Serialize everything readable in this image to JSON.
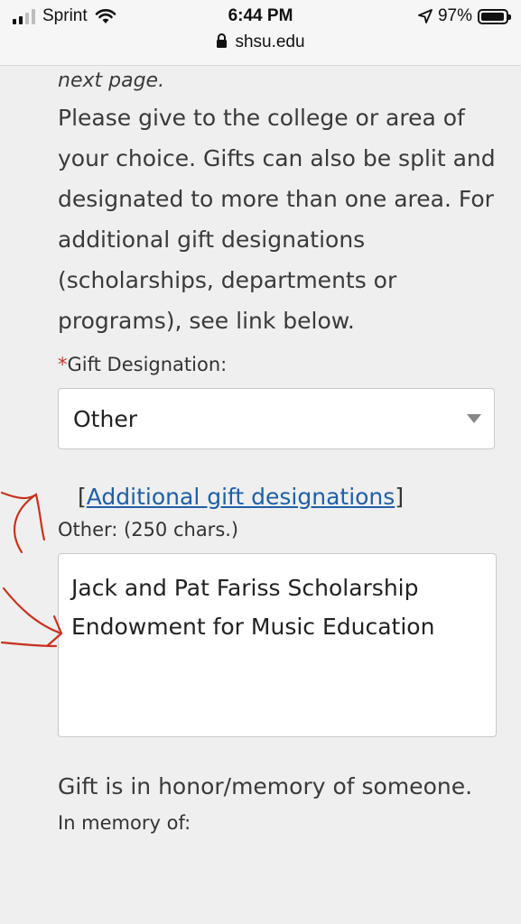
{
  "status_bar": {
    "carrier": "Sprint",
    "time": "6:44 PM",
    "battery": "97%",
    "battery_level": 0.97,
    "url": "shsu.edu"
  },
  "page": {
    "intro_italic": "next page.",
    "description": " Please give to the college or area of your choice. Gifts can also be split and designated to more than one area. For additional gift designations (scholarships, departments or programs), see link below.",
    "gift_designation": {
      "required_marker": "*",
      "label": "Gift Designation:",
      "selected": "Other"
    },
    "additional_link": {
      "open_bracket": "[",
      "text": "Additional gift designations",
      "close_bracket": "]"
    },
    "other": {
      "label": "Other: (250 chars.)",
      "value": "Jack and Pat Fariss Scholarship Endowment for Music Education"
    },
    "honor_text": "Gift is in honor/memory of someone.",
    "memory_label": "In memory of:"
  },
  "colors": {
    "background": "#efefef",
    "link": "#1f5fa6",
    "required": "#c0392b",
    "annotation": "#c8321e"
  }
}
